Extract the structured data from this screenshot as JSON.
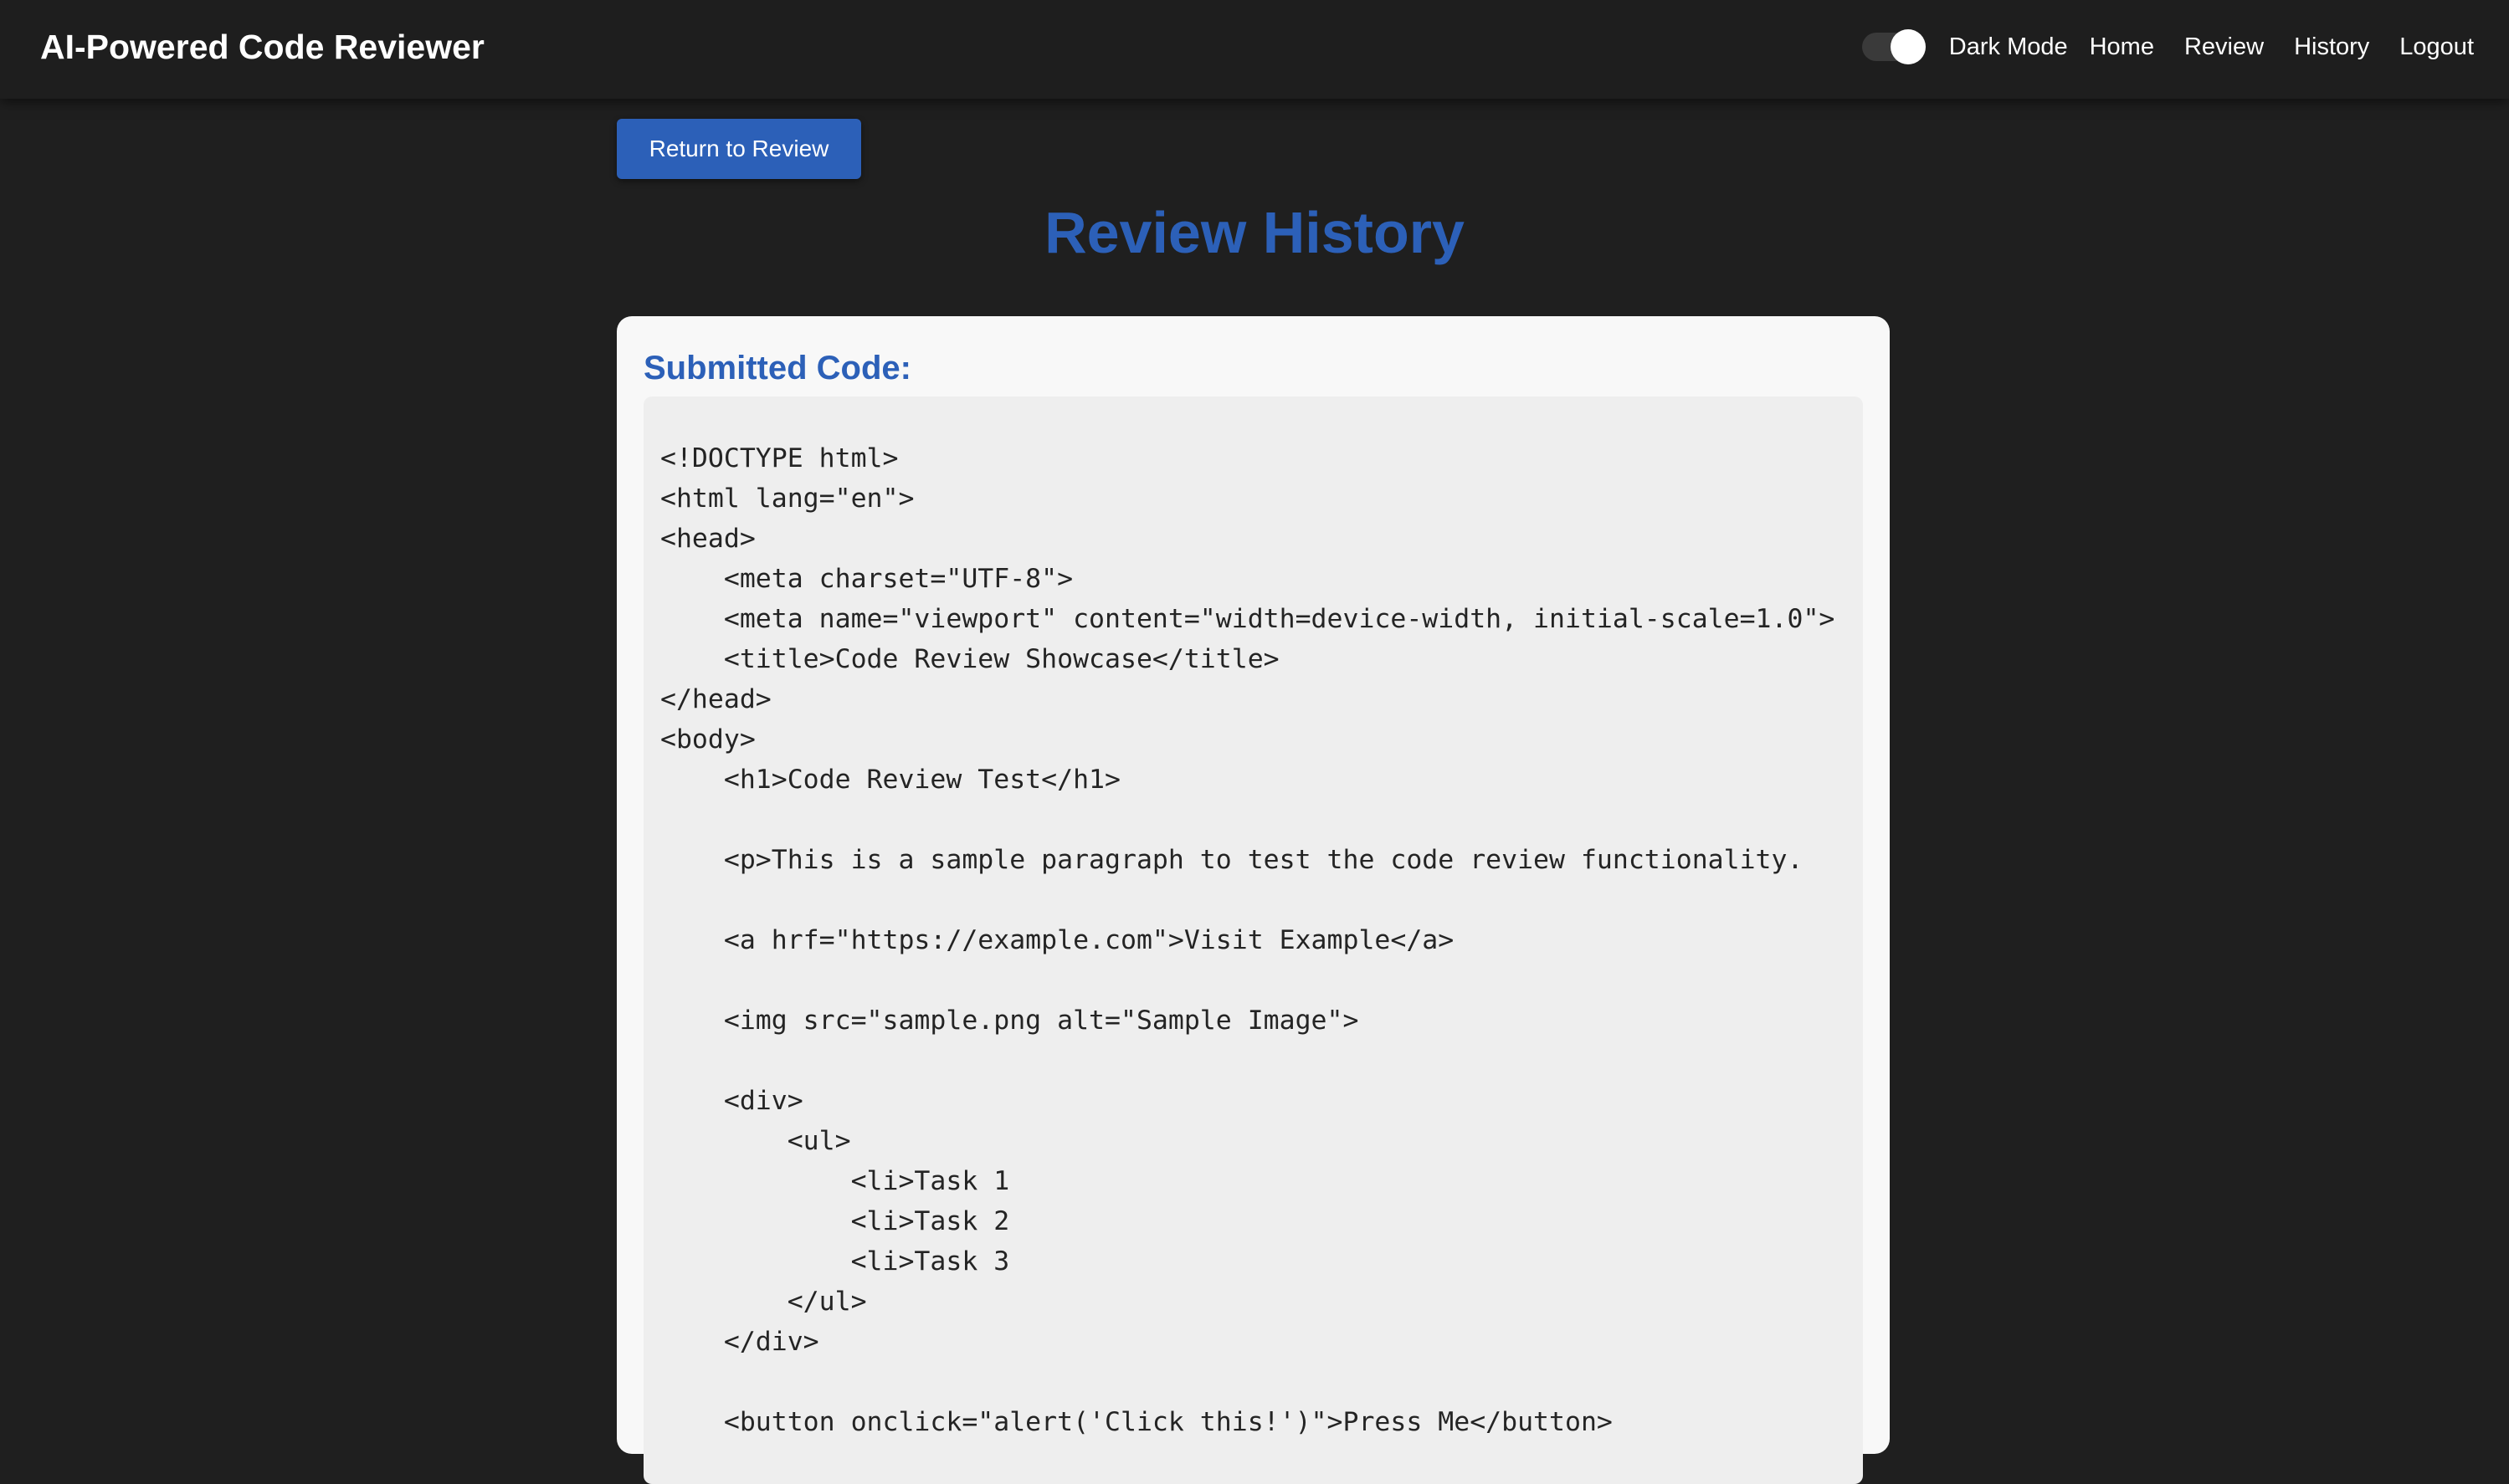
{
  "header": {
    "title": "AI-Powered Code Reviewer",
    "dark_mode_label": "Dark Mode",
    "dark_mode_on": true,
    "nav": [
      "Home",
      "Review",
      "History",
      "Logout"
    ]
  },
  "actions": {
    "return_label": "Return to Review"
  },
  "page": {
    "title": "Review History"
  },
  "entry": {
    "heading": "Submitted Code:",
    "code": "<!DOCTYPE html>\n<html lang=\"en\">\n<head>\n    <meta charset=\"UTF-8\">\n    <meta name=\"viewport\" content=\"width=device-width, initial-scale=1.0\">\n    <title>Code Review Showcase</title>\n</head>\n<body>\n    <h1>Code Review Test</h1>\n\n    <p>This is a sample paragraph to test the code review functionality.\n\n    <a hrf=\"https://example.com\">Visit Example</a>\n\n    <img src=\"sample.png alt=\"Sample Image\">\n\n    <div>\n        <ul>\n            <li>Task 1\n            <li>Task 2\n            <li>Task 3\n        </ul>\n    </div>\n\n    <button onclick=\"alert('Click this!')\">Press Me</button>"
  },
  "colors": {
    "background": "#1f1f1f",
    "topbar": "#1e1e1e",
    "accent": "#2c60b8",
    "card": "#f8f8f8",
    "code_background": "#eeeeee"
  }
}
